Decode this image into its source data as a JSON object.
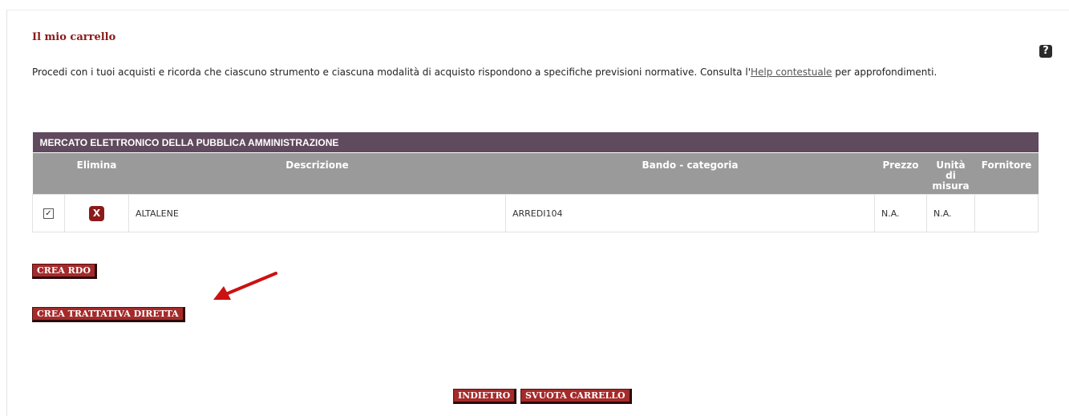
{
  "page": {
    "title": "Il mio carrello",
    "help_icon_glyph": "?",
    "intro_before": "Procedi con i tuoi acquisti e ricorda che ciascuno strumento e ciascuna modalità di acquisto rispondono a specifiche previsioni normative. Consulta l'",
    "intro_link": "Help contestuale",
    "intro_after": " per approfondimenti."
  },
  "table": {
    "section_title": "MERCATO ELETTRONICO DELLA PUBBLICA AMMINISTRAZIONE",
    "columns": {
      "elimina": "Elimina",
      "descrizione": "Descrizione",
      "bando": "Bando - categoria",
      "prezzo": "Prezzo",
      "unita_line1": "Unità",
      "unita_line2": "di",
      "unita_line3": "misura",
      "fornitore": "Fornitore"
    },
    "rows": [
      {
        "checked": true,
        "checkbox_glyph": "✓",
        "delete_glyph": "X",
        "descrizione": "ALTALENE",
        "bando": "ARREDI104",
        "prezzo": "N.A.",
        "unita": "N.A.",
        "fornitore": ""
      }
    ]
  },
  "actions": {
    "crea_rdo": "CREA RDO",
    "crea_trattativa": "CREA TRATTATIVA DIRETTA",
    "indietro": "INDIETRO",
    "svuota": "SVUOTA CARRELLO"
  },
  "colors": {
    "title": "#8b1a1a",
    "button": "#a52a2a",
    "section_header": "#604a5e",
    "column_header": "#9a9a9a",
    "annotation_arrow": "#cc1111"
  },
  "icons": {
    "help": "help-icon",
    "delete": "delete-icon",
    "checkbox": "checkbox-icon",
    "annotation": "red-arrow-annotation"
  }
}
